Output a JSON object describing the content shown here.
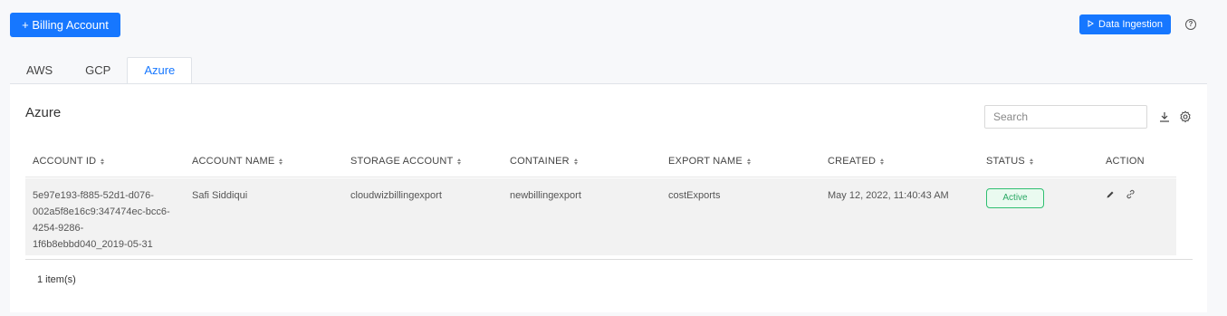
{
  "header": {
    "add_billing_label": "+ Billing Account",
    "data_ingestion_label": "Data Ingestion",
    "help_icon": "?"
  },
  "tabs": [
    {
      "label": "AWS",
      "active": false
    },
    {
      "label": "GCP",
      "active": false
    },
    {
      "label": "Azure",
      "active": true
    }
  ],
  "panel": {
    "title": "Azure",
    "search_placeholder": "Search"
  },
  "table": {
    "columns": [
      "ACCOUNT ID",
      "ACCOUNT NAME",
      "STORAGE ACCOUNT",
      "CONTAINER",
      "EXPORT NAME",
      "CREATED",
      "STATUS",
      "ACTION"
    ],
    "rows": [
      {
        "account_id_lines": [
          "5e97e193-f885-52d1-d076-",
          "002a5f8e16c9:347474ec-bcc6-",
          "4254-9286-",
          "1f6b8ebbd040_2019-05-31"
        ],
        "account_name": "Safi Siddiqui",
        "storage_account": "cloudwizbillingexport",
        "container": "newbillingexport",
        "export_name": "costExports",
        "created": "May 12, 2022, 11:40:43 AM",
        "status": "Active"
      }
    ]
  },
  "footer": {
    "count": "1 item(s)"
  },
  "colors": {
    "primary": "#1677ff",
    "active_badge": "#2aa864"
  }
}
